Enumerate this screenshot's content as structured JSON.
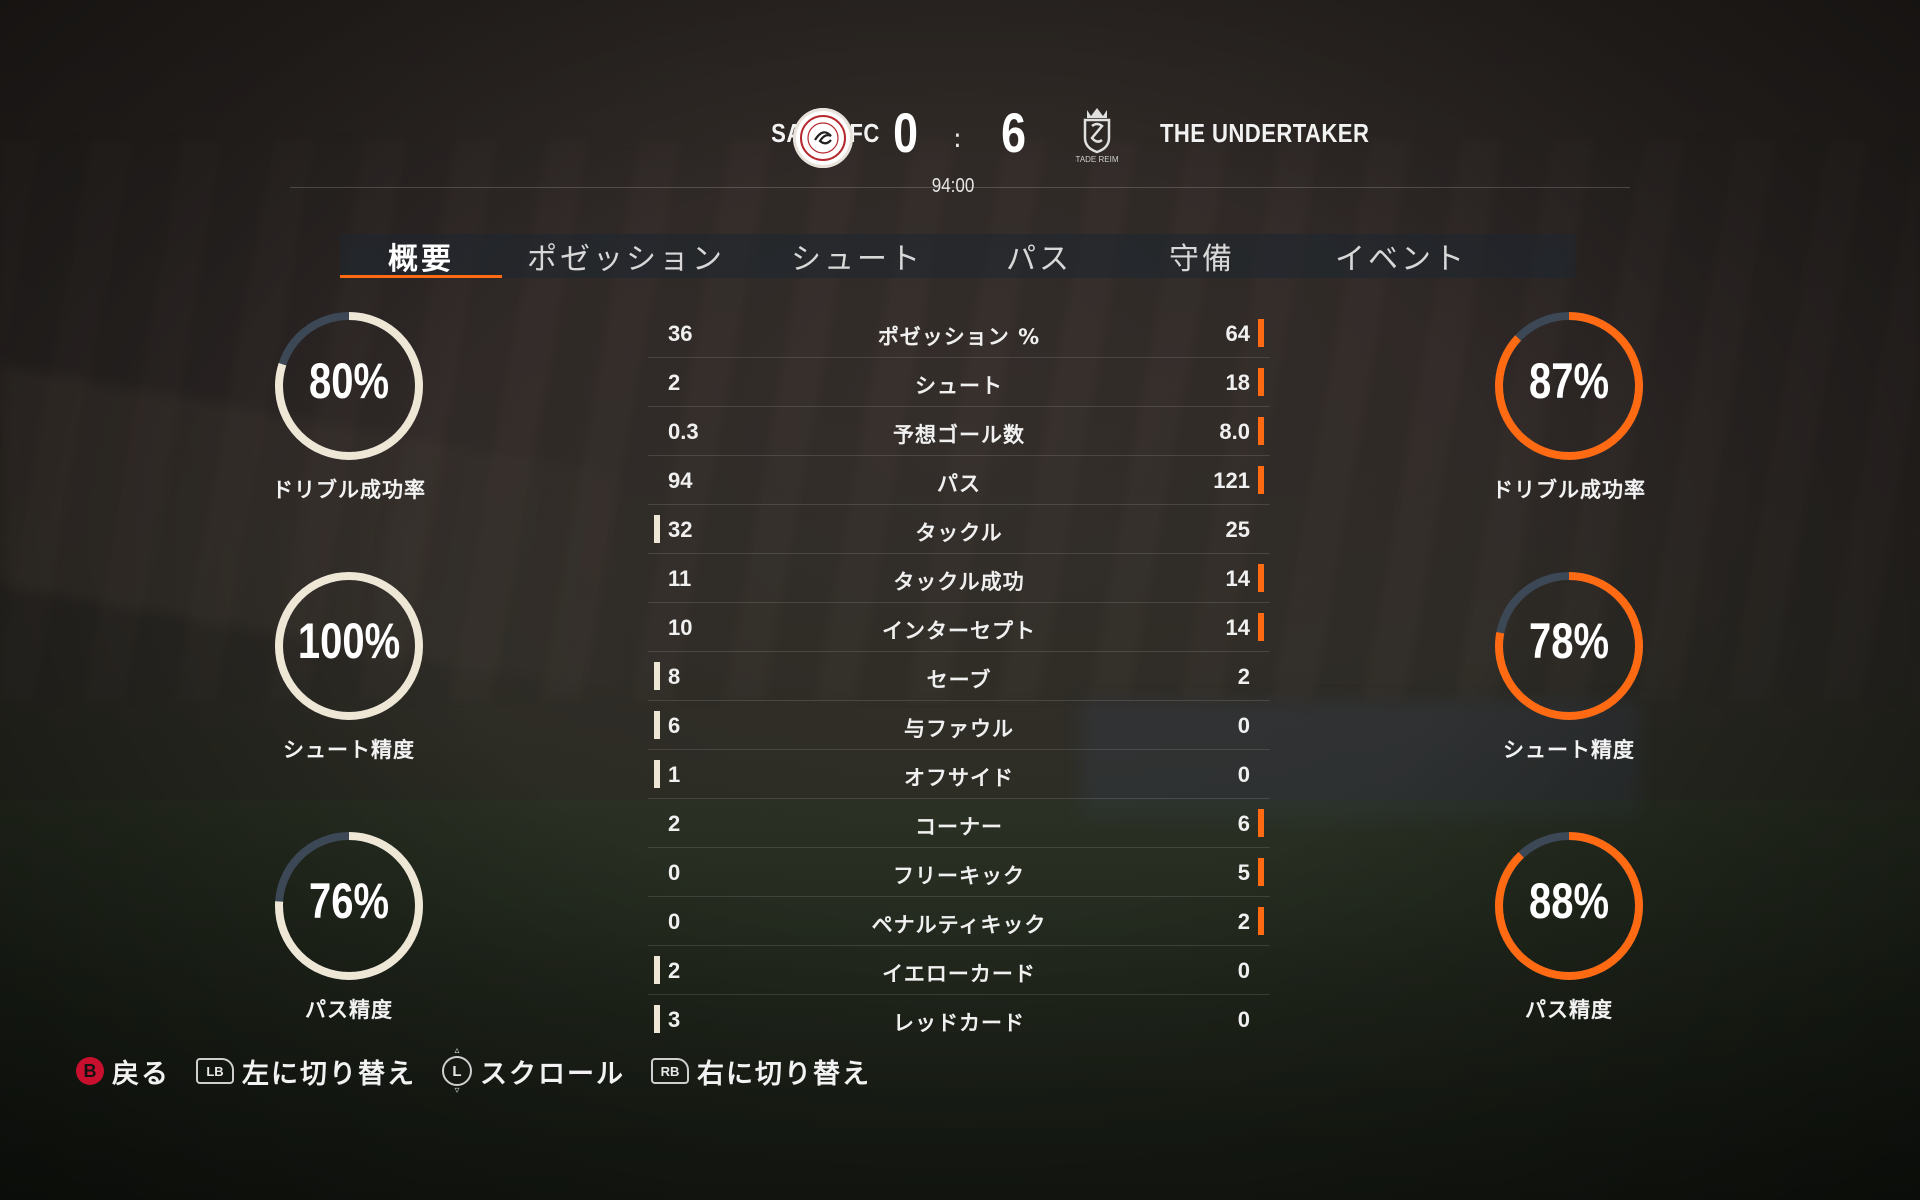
{
  "match": {
    "home_team": "SALTA FC",
    "away_team": "THE UNDERTAKER",
    "home_score": "0",
    "away_score": "6",
    "separator": ":",
    "clock": "94:00",
    "away_crest_text": "STADE REIMS"
  },
  "tabs": [
    {
      "label": "概要",
      "active": true
    },
    {
      "label": "ポゼッション",
      "active": false
    },
    {
      "label": "シュート",
      "active": false
    },
    {
      "label": "パス",
      "active": false
    },
    {
      "label": "守備",
      "active": false
    },
    {
      "label": "イベント",
      "active": false
    }
  ],
  "stats": [
    {
      "home": "36",
      "label": "ポゼッション %",
      "away": "64",
      "leader": "away"
    },
    {
      "home": "2",
      "label": "シュート",
      "away": "18",
      "leader": "away"
    },
    {
      "home": "0.3",
      "label": "予想ゴール数",
      "away": "8.0",
      "leader": "away"
    },
    {
      "home": "94",
      "label": "パス",
      "away": "121",
      "leader": "away"
    },
    {
      "home": "32",
      "label": "タックル",
      "away": "25",
      "leader": "home"
    },
    {
      "home": "11",
      "label": "タックル成功",
      "away": "14",
      "leader": "away"
    },
    {
      "home": "10",
      "label": "インターセプト",
      "away": "14",
      "leader": "away"
    },
    {
      "home": "8",
      "label": "セーブ",
      "away": "2",
      "leader": "home"
    },
    {
      "home": "6",
      "label": "与ファウル",
      "away": "0",
      "leader": "home"
    },
    {
      "home": "1",
      "label": "オフサイド",
      "away": "0",
      "leader": "home"
    },
    {
      "home": "2",
      "label": "コーナー",
      "away": "6",
      "leader": "away"
    },
    {
      "home": "0",
      "label": "フリーキック",
      "away": "5",
      "leader": "away"
    },
    {
      "home": "0",
      "label": "ペナルティキック",
      "away": "2",
      "leader": "away"
    },
    {
      "home": "2",
      "label": "イエローカード",
      "away": "0",
      "leader": "home"
    },
    {
      "home": "3",
      "label": "レッドカード",
      "away": "0",
      "leader": "home"
    }
  ],
  "gauges": {
    "home": [
      {
        "pct_text": "80%",
        "value": 80,
        "label": "ドリブル成功率"
      },
      {
        "pct_text": "100%",
        "value": 100,
        "label": "シュート精度"
      },
      {
        "pct_text": "76%",
        "value": 76,
        "label": "パス精度"
      }
    ],
    "away": [
      {
        "pct_text": "87%",
        "value": 87,
        "label": "ドリブル成功率"
      },
      {
        "pct_text": "78%",
        "value": 78,
        "label": "シュート精度"
      },
      {
        "pct_text": "88%",
        "value": 88,
        "label": "パス精度"
      }
    ]
  },
  "colors": {
    "home_accent": "#efe7d6",
    "away_accent": "#ff6a13",
    "gauge_track": "#3c4856"
  },
  "footer": {
    "back": {
      "button": "B",
      "label": "戻る"
    },
    "switch_left": {
      "button": "LB",
      "label": "左に切り替え"
    },
    "scroll": {
      "button": "L",
      "label": "スクロール"
    },
    "switch_right": {
      "button": "RB",
      "label": "右に切り替え"
    }
  }
}
